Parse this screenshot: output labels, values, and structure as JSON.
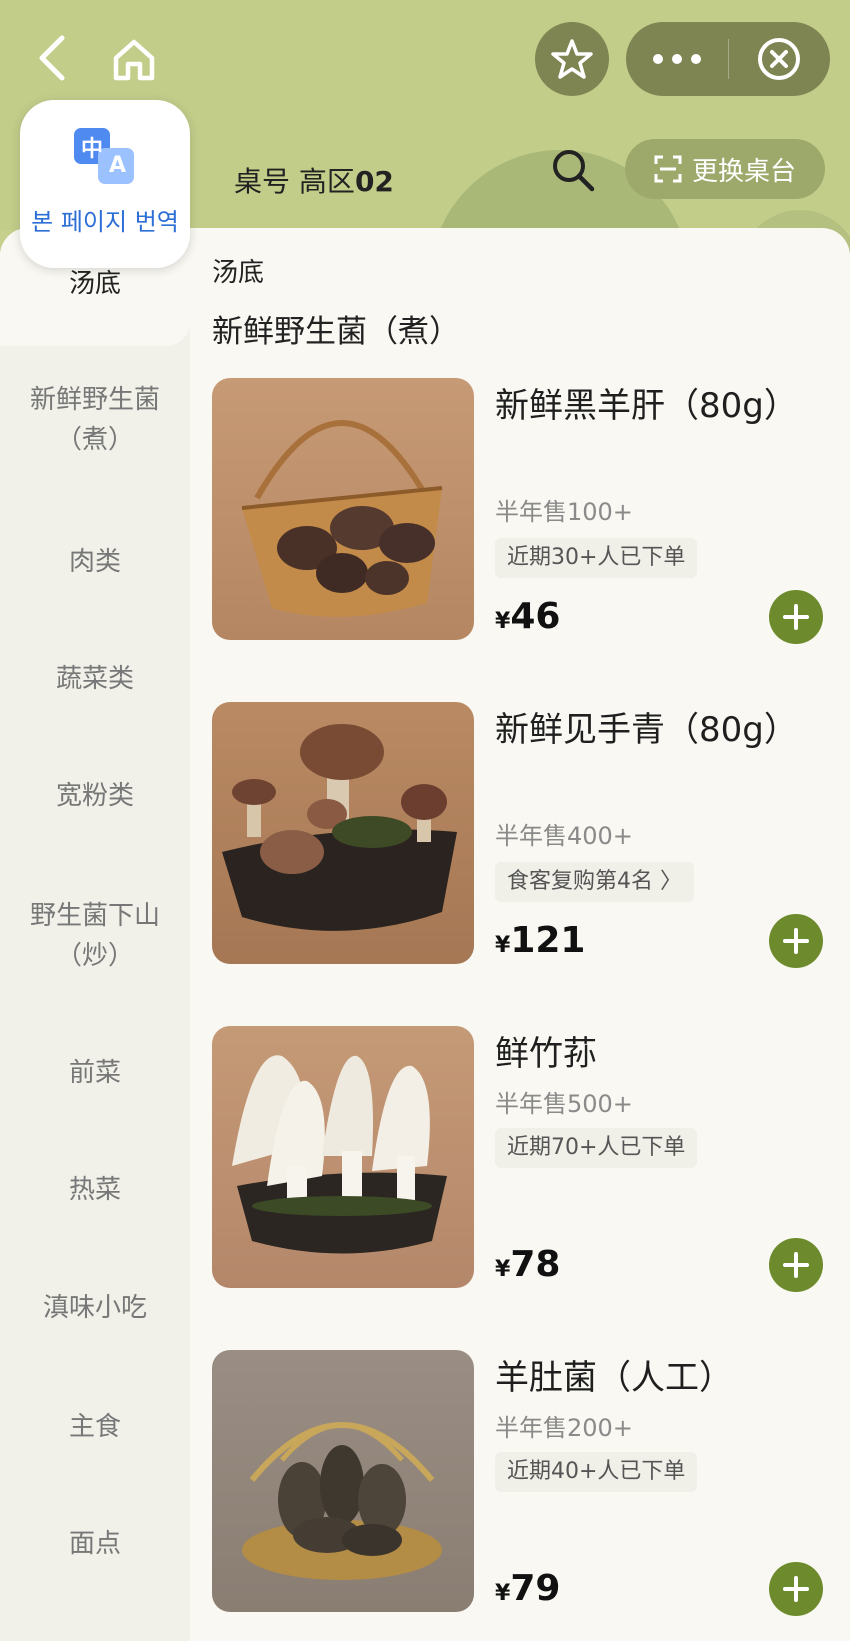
{
  "header": {
    "table_prefix": "桌号",
    "table_area": "高区",
    "table_number": "02",
    "change_table": "更换桌台",
    "icons": [
      "back-icon",
      "home-icon",
      "star-icon",
      "more-icon",
      "close-icon",
      "search-icon",
      "scan-icon"
    ]
  },
  "translate": {
    "label": "본 페이지 번역",
    "logo_top": "中",
    "logo_bottom": "A"
  },
  "sidebar": {
    "items": [
      {
        "label": "汤底"
      },
      {
        "label": "新鲜野生菌（煮）"
      },
      {
        "label": "肉类"
      },
      {
        "label": "蔬菜类"
      },
      {
        "label": "宽粉类"
      },
      {
        "label": "野生菌下山（炒）"
      },
      {
        "label": "前菜"
      },
      {
        "label": "热菜"
      },
      {
        "label": "滇味小吃"
      },
      {
        "label": "主食"
      },
      {
        "label": "面点"
      }
    ]
  },
  "main": {
    "section_prev": "汤底",
    "section_title": "新鲜野生菌（煮）",
    "products": [
      {
        "name": "新鲜黑羊肝（80g）",
        "sales": "半年售100+",
        "tag": "近期30+人已下单",
        "currency": "¥",
        "price": "46"
      },
      {
        "name": "新鲜见手青（80g）",
        "sales": "半年售400+",
        "tag": "食客复购第4名 〉",
        "currency": "¥",
        "price": "121"
      },
      {
        "name": "鲜竹荪",
        "sales": "半年售500+",
        "tag": "近期70+人已下单",
        "currency": "¥",
        "price": "78"
      },
      {
        "name": "羊肚菌（人工）",
        "sales": "半年售200+",
        "tag": "近期40+人已下单",
        "currency": "¥",
        "price": "79"
      }
    ]
  },
  "colors": {
    "header_bg": "#c3cd8a",
    "accent": "#6d8b2c",
    "capsule": "#7e8552",
    "translate_blue": "#2e6fd6"
  }
}
